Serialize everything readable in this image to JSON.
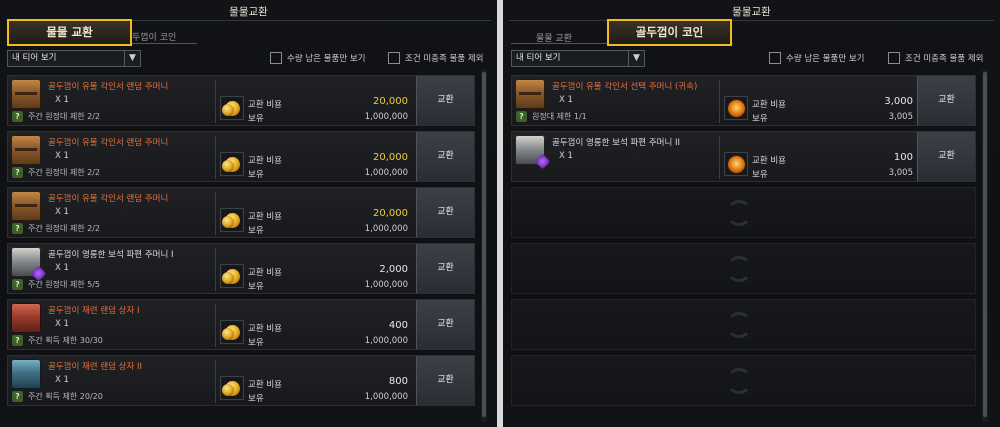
{
  "left": {
    "title": "물물교환",
    "tabs": {
      "active": "물물 교환",
      "inactive": "두껍이 코인"
    },
    "dropdown": "내 티어 보기",
    "filters": {
      "remaining": "수량 남은 물품만 보기",
      "exclude": "조건 미충족 물품 제외"
    },
    "cost_label": "교환 비용",
    "owned_label": "보유",
    "button": "교환",
    "items": [
      {
        "name": "골두껍이 유물 각인서 랜덤 주머니",
        "qty": "X 1",
        "limit": "주간 원정대 제한 2/2",
        "cost": "20,000",
        "owned": "1,000,000",
        "icon": "chest-icon",
        "cost_color": "#f1cc3c"
      },
      {
        "name": "골두껍이 유물 각인서 랜덤 주머니",
        "qty": "X 1",
        "limit": "주간 원정대 제한 2/2",
        "cost": "20,000",
        "owned": "1,000,000",
        "icon": "chest-icon",
        "cost_color": "#f1cc3c"
      },
      {
        "name": "골두껍이 유물 각인서 랜덤 주머니",
        "qty": "X 1",
        "limit": "주간 원정대 제한 2/2",
        "cost": "20,000",
        "owned": "1,000,000",
        "icon": "chest-icon",
        "cost_color": "#f1cc3c"
      },
      {
        "name": "골두껍이 영롱한 보석 파편 주머니 I",
        "qty": "X 1",
        "limit": "주간 원정대 제한 5/5",
        "cost": "2,000",
        "owned": "1,000,000",
        "icon": "silver-chest-icon",
        "cost_color": "#e8e8e8"
      },
      {
        "name": "골두껍이 재련 랜덤 상자 I",
        "qty": "X 1",
        "limit": "주간 획득 제한 30/30",
        "cost": "400",
        "owned": "1,000,000",
        "icon": "red-box-icon",
        "cost_color": "#e8e8e8"
      },
      {
        "name": "골두껍이 재련 랜덤 상자 II",
        "qty": "X 1",
        "limit": "주간 획득 제한 20/20",
        "cost": "800",
        "owned": "1,000,000",
        "icon": "blue-box-icon",
        "cost_color": "#e8e8e8"
      }
    ]
  },
  "right": {
    "title": "물물교환",
    "tabs": {
      "active": "골두껍이 코인",
      "inactive": "물물 교환"
    },
    "dropdown": "내 티어 보기",
    "filters": {
      "remaining": "수량 남은 물품만 보기",
      "exclude": "조건 미충족 물품 제외"
    },
    "cost_label": "교환 비용",
    "owned_label": "보유",
    "button": "교환",
    "items": [
      {
        "name": "골두껍이 유물 각인서 선택 주머니 (귀속)",
        "qty": "X 1",
        "limit": "원정대 제한 1/1",
        "cost": "3,000",
        "owned": "3,005",
        "icon": "chest-icon"
      },
      {
        "name": "골두껍이 영롱한 보석 파편 주머니 II",
        "qty": "X 1",
        "limit": "",
        "cost": "100",
        "owned": "3,005",
        "icon": "silver-chest-icon"
      }
    ]
  }
}
